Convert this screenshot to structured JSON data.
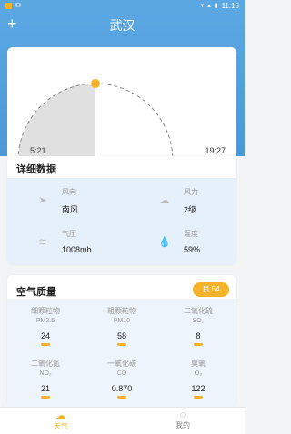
{
  "status": {
    "time": "11:15"
  },
  "header": {
    "city": "武汉",
    "add_label": "+"
  },
  "sun": {
    "sunrise": "5:21",
    "sunset": "19:27"
  },
  "detail": {
    "title": "详细数据",
    "items": [
      {
        "label": "风向",
        "value": "南风",
        "icon": "wind-direction-icon"
      },
      {
        "label": "风力",
        "value": "2级",
        "icon": "wind-power-icon"
      },
      {
        "label": "气压",
        "value": "1008mb",
        "icon": "pressure-icon"
      },
      {
        "label": "湿度",
        "value": "59%",
        "icon": "humidity-icon"
      }
    ]
  },
  "air": {
    "title": "空气质量",
    "badge": "良 54",
    "items": [
      {
        "name": "细颗粒物",
        "code": "PM2.5",
        "value": "24"
      },
      {
        "name": "粗颗粒物",
        "code": "PM10",
        "value": "58"
      },
      {
        "name": "二氧化硫",
        "code": "SO₂",
        "value": "8"
      },
      {
        "name": "二氧化氮",
        "code": "NO₂",
        "value": "21"
      },
      {
        "name": "一氧化碳",
        "code": "CO",
        "value": "0.870"
      },
      {
        "name": "臭氧",
        "code": "O₃",
        "value": "122"
      }
    ]
  },
  "tabs": [
    {
      "label": "天气",
      "icon": "weather-icon",
      "active": true
    },
    {
      "label": "我的",
      "icon": "profile-icon",
      "active": false
    }
  ],
  "colors": {
    "primary": "#5ba7e2",
    "accent": "#f5b32a",
    "active_tab": "#f5b32a"
  }
}
